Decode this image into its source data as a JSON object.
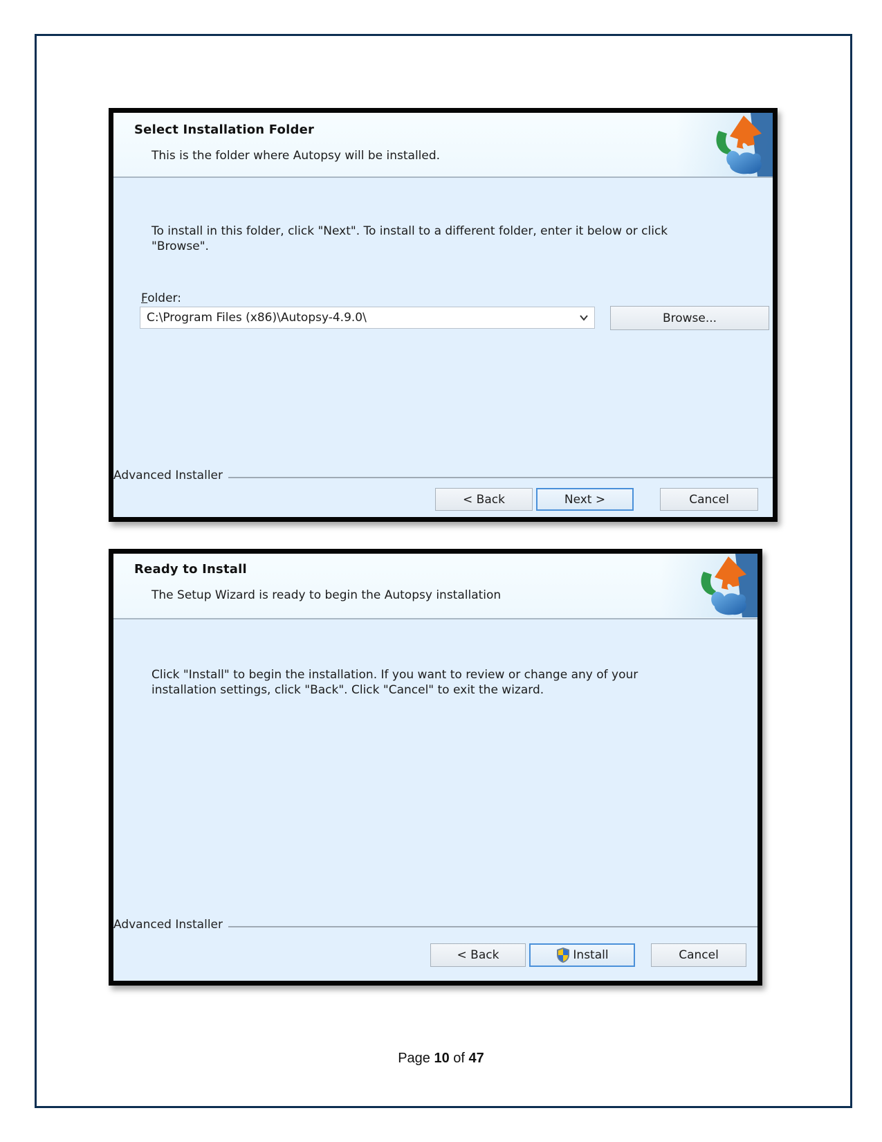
{
  "dialogs": [
    {
      "title": "Select Installation Folder",
      "subtitle": "This is the folder where Autopsy will be installed.",
      "body_lines": [
        "To install in this folder, click \"Next\". To install to a different folder, enter it below or click",
        "\"Browse\"."
      ],
      "folder_label_accel": "F",
      "folder_label_rest": "older:",
      "folder_value": "C:\\Program Files (x86)\\Autopsy-4.9.0\\",
      "browse_label": "Browse...",
      "brand": "Advanced Installer",
      "buttons": {
        "back": "< Back",
        "next": "Next >",
        "cancel": "Cancel"
      }
    },
    {
      "title": "Ready to Install",
      "subtitle": "The Setup Wizard is ready to begin the Autopsy installation",
      "body_lines": [
        "Click \"Install\" to begin the installation.  If you want to review or change any of your",
        "installation settings, click \"Back\".  Click \"Cancel\" to exit the wizard."
      ],
      "brand": "Advanced Installer",
      "buttons": {
        "back": "< Back",
        "install": "Install",
        "cancel": "Cancel"
      }
    }
  ],
  "footer": {
    "page_word": "Page",
    "current_page": "10",
    "of_word": "of",
    "total_pages": "47"
  },
  "colors": {
    "page_border": "#0d2f52",
    "dialog_bg": "#e2f0fd",
    "default_button_border": "#4a90d9"
  }
}
